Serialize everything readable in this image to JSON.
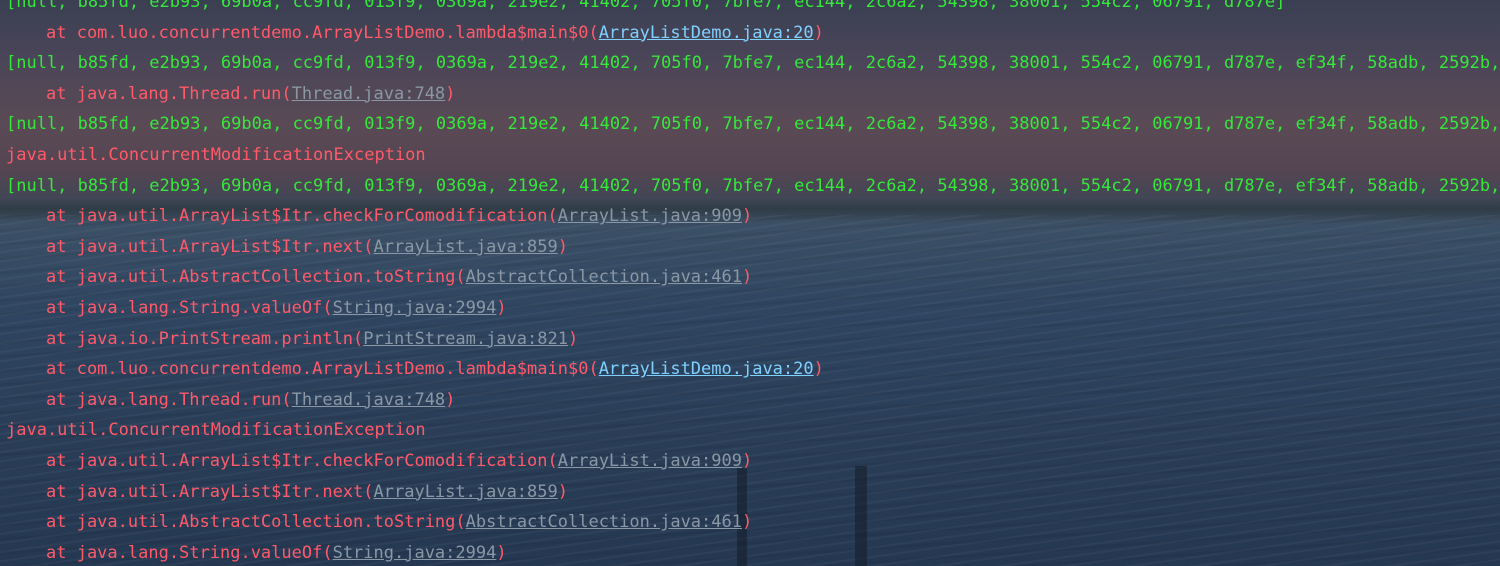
{
  "console": {
    "lines": [
      {
        "kind": "out",
        "text": "[null, b85fd, e2b93, 69b0a, cc9fd, 013f9, 0369a, 219e2, 41402, 705f0, 7bfe7, ec144, 2c6a2, 54398, 38001, 554c2, 06791, d787e]"
      },
      {
        "kind": "frame",
        "prefix": "at com.luo.concurrentdemo.ArrayListDemo.lambda$main$0(",
        "link": "ArrayListDemo.java:20",
        "suffix": ")"
      },
      {
        "kind": "out",
        "text": "[null, b85fd, e2b93, 69b0a, cc9fd, 013f9, 0369a, 219e2, 41402, 705f0, 7bfe7, ec144, 2c6a2, 54398, 38001, 554c2, 06791, d787e, ef34f, 58adb, 2592b,"
      },
      {
        "kind": "frame",
        "prefix": "at java.lang.Thread.run(",
        "link": "Thread.java:748",
        "suffix": ")"
      },
      {
        "kind": "out",
        "text": "[null, b85fd, e2b93, 69b0a, cc9fd, 013f9, 0369a, 219e2, 41402, 705f0, 7bfe7, ec144, 2c6a2, 54398, 38001, 554c2, 06791, d787e, ef34f, 58adb, 2592b,"
      },
      {
        "kind": "exception",
        "text": "java.util.ConcurrentModificationException"
      },
      {
        "kind": "out",
        "text": "[null, b85fd, e2b93, 69b0a, cc9fd, 013f9, 0369a, 219e2, 41402, 705f0, 7bfe7, ec144, 2c6a2, 54398, 38001, 554c2, 06791, d787e, ef34f, 58adb, 2592b,"
      },
      {
        "kind": "frame",
        "prefix": "at java.util.ArrayList$Itr.checkForComodification(",
        "link": "ArrayList.java:909",
        "suffix": ")"
      },
      {
        "kind": "frame",
        "prefix": "at java.util.ArrayList$Itr.next(",
        "link": "ArrayList.java:859",
        "suffix": ")"
      },
      {
        "kind": "frame",
        "prefix": "at java.util.AbstractCollection.toString(",
        "link": "AbstractCollection.java:461",
        "suffix": ")"
      },
      {
        "kind": "frame",
        "prefix": "at java.lang.String.valueOf(",
        "link": "String.java:2994",
        "suffix": ")"
      },
      {
        "kind": "frame",
        "prefix": "at java.io.PrintStream.println(",
        "link": "PrintStream.java:821",
        "suffix": ")"
      },
      {
        "kind": "frame",
        "prefix": "at com.luo.concurrentdemo.ArrayListDemo.lambda$main$0(",
        "link": "ArrayListDemo.java:20",
        "suffix": ")"
      },
      {
        "kind": "frame",
        "prefix": "at java.lang.Thread.run(",
        "link": "Thread.java:748",
        "suffix": ")"
      },
      {
        "kind": "exception",
        "text": "java.util.ConcurrentModificationException"
      },
      {
        "kind": "frame",
        "prefix": "at java.util.ArrayList$Itr.checkForComodification(",
        "link": "ArrayList.java:909",
        "suffix": ")"
      },
      {
        "kind": "frame",
        "prefix": "at java.util.ArrayList$Itr.next(",
        "link": "ArrayList.java:859",
        "suffix": ")"
      },
      {
        "kind": "frame",
        "prefix": "at java.util.AbstractCollection.toString(",
        "link": "AbstractCollection.java:461",
        "suffix": ")"
      },
      {
        "kind": "frame",
        "prefix": "at java.lang.String.valueOf(",
        "link": "String.java:2994",
        "suffix": ")"
      }
    ]
  },
  "colors": {
    "stdout": "#35e83a",
    "stderr": "#ff5a6a",
    "project_link": "#7fd0ff",
    "library_link": "#8a98a6"
  }
}
